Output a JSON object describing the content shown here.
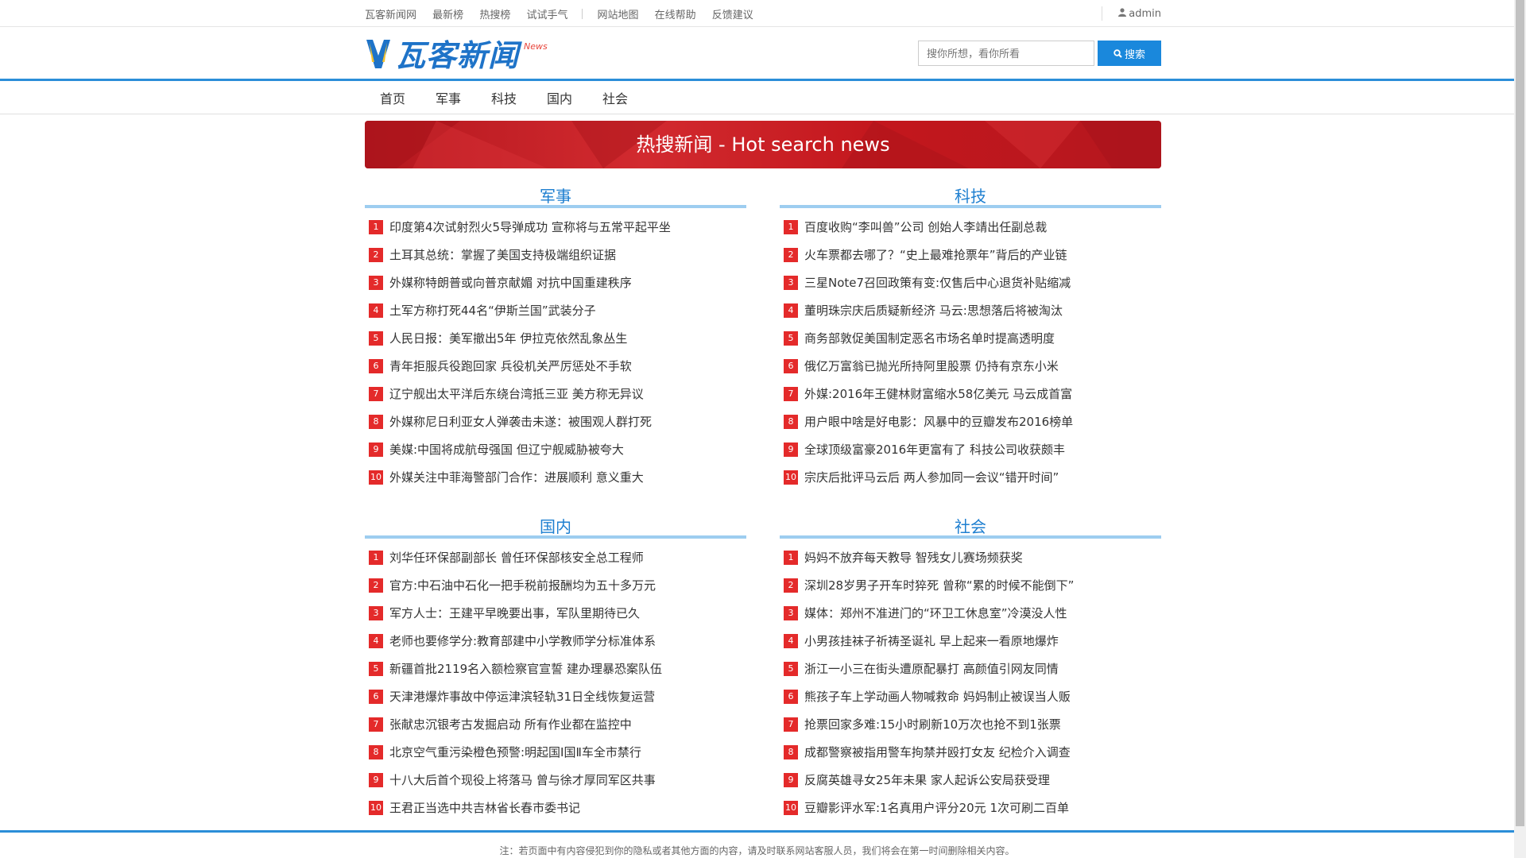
{
  "topbar": {
    "links_left": [
      "瓦客新闻网",
      "最新榜",
      "热搜榜",
      "试试手气"
    ],
    "links_right": [
      "网站地图",
      "在线帮助",
      "反馈建议"
    ],
    "user": "admin"
  },
  "header": {
    "logo_text": "瓦客新闻",
    "logo_sub": "News",
    "search_placeholder": "搜你所想，看你所看",
    "search_button": "搜索"
  },
  "nav": [
    "首页",
    "军事",
    "科技",
    "国内",
    "社会"
  ],
  "banner": {
    "title": "热搜新闻 - Hot search news"
  },
  "sections": [
    {
      "title": "军事",
      "items": [
        "印度第4次试射烈火5导弹成功 宣称将与五常平起平坐",
        "土耳其总统：掌握了美国支持极端组织证据",
        "外媒称特朗普或向普京献媚 对抗中国重建秩序",
        "土军方称打死44名“伊斯兰国”武装分子",
        "人民日报：美军撤出5年 伊拉克依然乱象丛生",
        "青年拒服兵役跑回家 兵役机关严厉惩处不手软",
        "辽宁舰出太平洋后东绕台湾抵三亚 美方称无异议",
        "外媒称尼日利亚女人弹袭击未遂：被围观人群打死",
        "美媒:中国将成航母强国 但辽宁舰威胁被夸大",
        "外媒关注中菲海警部门合作：进展顺利 意义重大"
      ]
    },
    {
      "title": "科技",
      "items": [
        "百度收购“李叫兽”公司 创始人李靖出任副总裁",
        "火车票都去哪了？“史上最难抢票年”背后的产业链",
        "三星Note7召回政策有变:仅售后中心退货补贴缩减",
        "董明珠宗庆后质疑新经济 马云:思想落后将被淘汰",
        "商务部敦促美国制定恶名市场名单时提高透明度",
        "俄亿万富翁已抛光所持阿里股票 仍持有京东小米",
        "外媒:2016年王健林财富缩水58亿美元 马云成首富",
        "用户眼中啥是好电影：风暴中的豆瓣发布2016榜单",
        "全球顶级富豪2016年更富有了 科技公司收获颇丰",
        "宗庆后批评马云后 两人参加同一会议“错开时间”"
      ]
    },
    {
      "title": "国内",
      "items": [
        "刘华任环保部副部长 曾任环保部核安全总工程师",
        "官方:中石油中石化一把手税前报酬均为五十多万元",
        "军方人士：王建平早晚要出事，军队里期待已久",
        "老师也要修学分:教育部建中小学教师学分标准体系",
        "新疆首批2119名入额检察官宣誓 建办理暴恐案队伍",
        "天津港爆炸事故中停运津滨轻轨31日全线恢复运营",
        "张献忠沉银考古发掘启动 所有作业都在监控中",
        "北京空气重污染橙色预警:明起国Ⅰ国Ⅱ车全市禁行",
        "十八大后首个现役上将落马 曾与徐才厚同军区共事",
        "王君正当选中共吉林省长春市委书记"
      ]
    },
    {
      "title": "社会",
      "items": [
        "妈妈不放弃每天教导 智残女儿赛场频获奖",
        "深圳28岁男子开车时猝死 曾称“累的时候不能倒下”",
        "媒体：郑州不准进门的“环卫工休息室”冷漠没人性",
        "小男孩挂袜子祈祷圣诞礼 早上起来一看原地爆炸",
        "浙江一小三在街头遭原配暴打 高颜值引网友同情",
        "熊孩子车上学动画人物喊救命 妈妈制止被误当人贩",
        "抢票回家多难:15小时刷新10万次也抢不到1张票",
        "成都警察被指用警车拘禁并殴打女友 纪检介入调查",
        "反腐英雄寻女25年未果 家人起诉公安局获受理",
        "豆瓣影评水军:1名真用户评分20元 1次可刷二百单"
      ]
    }
  ],
  "footer": {
    "note": "注：若页面中有内容侵犯到你的隐私或者其他方面的内容，请及时联系网站客服人员，我们将会在第一时间删除相关内容。"
  },
  "colors": {
    "accent": "#1a88dc",
    "nav_border": "#2b8ed8",
    "banner_red": "#c81e24",
    "rank_badge": "#e42a2a",
    "section_title": "#1e7fd0"
  }
}
